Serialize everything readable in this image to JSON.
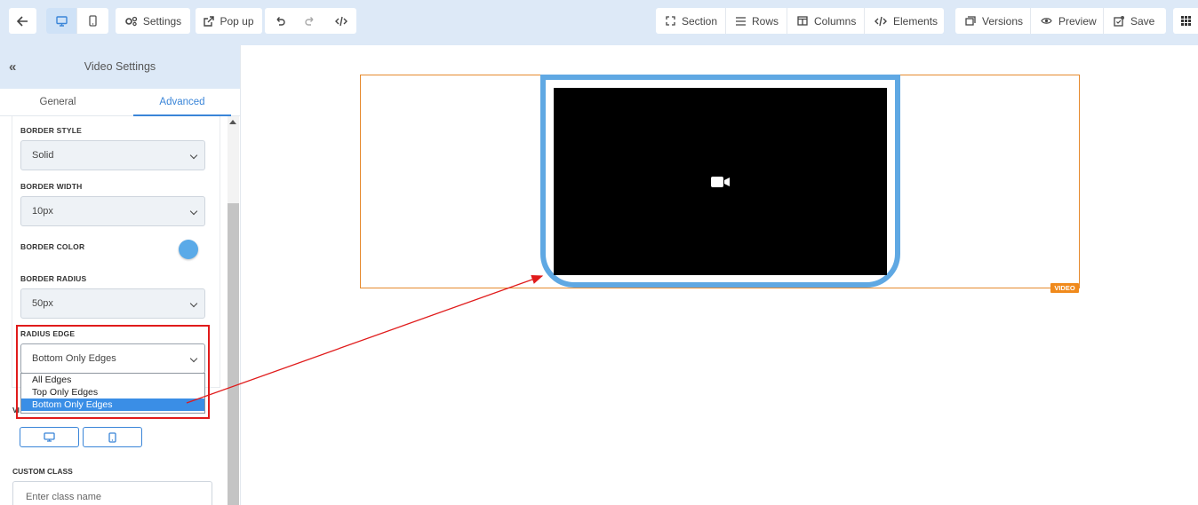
{
  "toolbar": {
    "back_icon": "arrow-left-icon",
    "desktop_icon": "desktop-icon",
    "mobile_icon": "mobile-icon",
    "settings_label": "Settings",
    "popup_label": "Pop up",
    "undo_icon": "undo-icon",
    "redo_icon": "redo-icon",
    "code_icon": "code-icon",
    "section_label": "Section",
    "rows_label": "Rows",
    "columns_label": "Columns",
    "elements_label": "Elements",
    "versions_label": "Versions",
    "preview_label": "Preview",
    "save_label": "Save",
    "grid_icon": "grid-icon"
  },
  "sidebar": {
    "title": "Video Settings",
    "tabs": [
      {
        "label": "General",
        "active": false
      },
      {
        "label": "Advanced",
        "active": true
      }
    ],
    "fields": {
      "border_style": {
        "label": "BORDER STYLE",
        "value": "Solid"
      },
      "border_width": {
        "label": "BORDER WIDTH",
        "value": "10px"
      },
      "border_color": {
        "label": "BORDER COLOR",
        "value": "#5aaae8"
      },
      "border_radius": {
        "label": "BORDER RADIUS",
        "value": "50px"
      },
      "radius_edge": {
        "label": "RADIUS EDGE",
        "value": "Bottom Only Edges",
        "options": [
          "All Edges",
          "Top Only Edges",
          "Bottom Only Edges"
        ],
        "selected_index": 2
      }
    },
    "visibility_label": "VI",
    "custom_class": {
      "label": "CUSTOM CLASS",
      "placeholder": "Enter class name"
    }
  },
  "canvas": {
    "video_tag": "VIDEO",
    "accent_color": "#f08a1c",
    "frame_border_color": "#5fa8e3"
  },
  "colors": {
    "toolbar_bg": "#dde9f7",
    "primary": "#3a85d8",
    "annotation": "#e01b1b"
  }
}
